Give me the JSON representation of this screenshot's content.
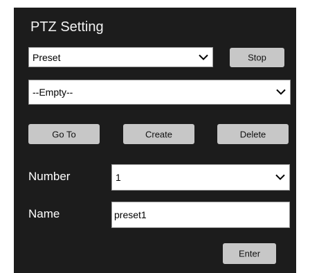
{
  "panel": {
    "title": "PTZ Setting"
  },
  "mode_select": {
    "value": "Preset",
    "icon": "chevron-down-icon"
  },
  "stop_button": {
    "label": "Stop"
  },
  "preset_select": {
    "value": "--Empty--",
    "icon": "chevron-down-icon"
  },
  "actions": {
    "goto_label": "Go To",
    "create_label": "Create",
    "delete_label": "Delete"
  },
  "number": {
    "label": "Number",
    "value": "1",
    "icon": "chevron-down-icon"
  },
  "name": {
    "label": "Name",
    "value": "preset1"
  },
  "enter_button": {
    "label": "Enter"
  },
  "colors": {
    "panel_bg": "#1c1c1c",
    "button_bg": "#c7c7c7",
    "text_light": "#ffffff"
  }
}
